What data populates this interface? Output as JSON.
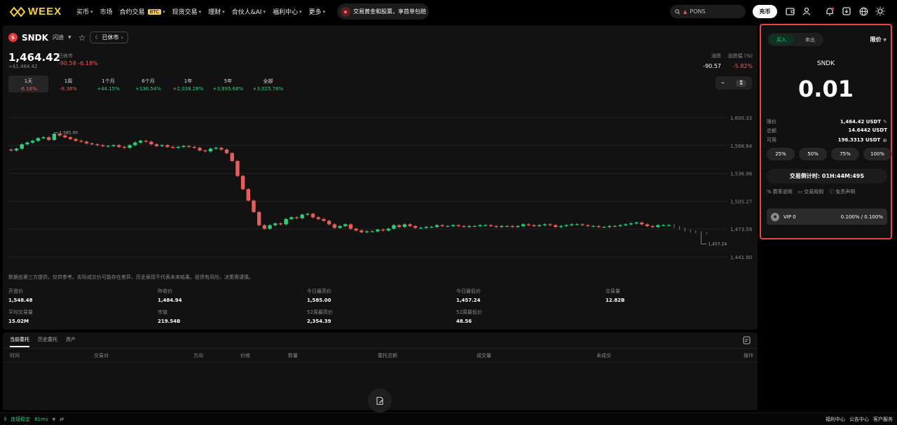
{
  "colors": {
    "accent": "#f4d03f",
    "up": "#2ecf7d",
    "down": "#e85d5d",
    "highlight_border": "#e84545"
  },
  "nav": {
    "logo": "WEEX",
    "items": [
      {
        "label": "买币",
        "chevron": true
      },
      {
        "label": "市场",
        "chevron": false
      },
      {
        "label": "合约交易",
        "badge": "BTC",
        "chevron": true
      },
      {
        "label": "现货交易",
        "chevron": true
      },
      {
        "label": "理财",
        "chevron": true
      },
      {
        "label": "合伙人&AI",
        "chevron": true
      },
      {
        "label": "福利中心",
        "chevron": true
      },
      {
        "label": "更多",
        "chevron": true
      }
    ],
    "promo": "交易黄金和股票，享首单包赔",
    "search_placeholder": "PONS",
    "deposit": "充币",
    "icons": [
      "wallet-icon",
      "user-icon",
      "bell-icon",
      "download-icon",
      "globe-icon",
      "sun-icon"
    ]
  },
  "symbol": {
    "name": "SNDK",
    "sub": "闪迪",
    "market_status": "已休市",
    "price": "1,464.42",
    "price_usd": "≈$1,464.42",
    "closed_label": "已休市",
    "closed_change": "-90.58 -6.18%",
    "change_label": "涨跌",
    "change_value": "-90.57",
    "pct_label": "涨跌幅 (%)",
    "pct_value": "-5.82%"
  },
  "periods": [
    {
      "name": "1天",
      "pct": "-6.18%",
      "dir": "down",
      "active": true
    },
    {
      "name": "1周",
      "pct": "-8.38%",
      "dir": "down",
      "active": false
    },
    {
      "name": "1个月",
      "pct": "+44.15%",
      "dir": "up",
      "active": false
    },
    {
      "name": "6个月",
      "pct": "+136.54%",
      "dir": "up",
      "active": false
    },
    {
      "name": "1年",
      "pct": "+2,038.28%",
      "dir": "up",
      "active": false
    },
    {
      "name": "5年",
      "pct": "+3,895.68%",
      "dir": "up",
      "active": false
    },
    {
      "name": "全部",
      "pct": "+3,025.76%",
      "dir": "up",
      "active": false
    }
  ],
  "chart_data": {
    "type": "candlestick",
    "y_ticks": [
      "1,600.33",
      "1,568.64",
      "1,536.96",
      "1,505.27",
      "1,473.59",
      "1,441.90"
    ],
    "ylim": [
      1441.9,
      1600.33
    ],
    "annotations": {
      "high": "1,585.00",
      "low": "1,457.24"
    },
    "closes": [
      1563,
      1565,
      1570,
      1572,
      1574,
      1577,
      1578,
      1575,
      1582,
      1580,
      1578,
      1576,
      1574,
      1573,
      1571,
      1570,
      1569,
      1568,
      1568,
      1569,
      1567,
      1566,
      1569,
      1572,
      1574,
      1573,
      1570,
      1568,
      1569,
      1567,
      1566,
      1567,
      1568,
      1567,
      1566,
      1563,
      1562,
      1565,
      1566,
      1564,
      1560,
      1551,
      1534,
      1519,
      1506,
      1493,
      1478,
      1474,
      1478,
      1480,
      1479,
      1485,
      1487,
      1486,
      1490,
      1491,
      1487,
      1485,
      1483,
      1479,
      1475,
      1477,
      1479,
      1474,
      1472,
      1470,
      1471,
      1471,
      1473,
      1472,
      1474,
      1478,
      1476,
      1479,
      1477,
      1475,
      1475,
      1476,
      1476,
      1478,
      1477,
      1477,
      1478,
      1477,
      1476,
      1477,
      1477,
      1478,
      1478,
      1477,
      1476,
      1477,
      1477,
      1476,
      1477,
      1479,
      1478,
      1477,
      1478,
      1479,
      1478,
      1476,
      1477,
      1478,
      1479,
      1479,
      1478,
      1477,
      1477,
      1476,
      1476,
      1477,
      1477,
      1478,
      1479,
      1480,
      1481,
      1479,
      1477,
      1476,
      1478,
      1478,
      1478,
      1476,
      1474,
      1472,
      1471,
      1470,
      1469,
      1469
    ],
    "closed_after_index": 122
  },
  "disclaimer": "数据由第三方提供，仅供参考。实际成交价可能存在差异，历史表现不代表未来结果。投资有风险，决策需谨慎。",
  "stats": [
    {
      "label": "开盘价",
      "value": "1,548.48"
    },
    {
      "label": "昨收价",
      "value": "1,484.94"
    },
    {
      "label": "今日最高价",
      "value": "1,585.00"
    },
    {
      "label": "今日最低价",
      "value": "1,457.24"
    },
    {
      "label": "交易量",
      "value": "12.82B"
    },
    {
      "label": "平均交易量",
      "value": "15.02M"
    },
    {
      "label": "市值",
      "value": "219.54B"
    },
    {
      "label": "52周最高价",
      "value": "2,354.39"
    },
    {
      "label": "52周最低价",
      "value": "48.56"
    }
  ],
  "orders": {
    "tabs": [
      "当前委托",
      "历史委托",
      "资产"
    ],
    "columns": [
      "时间",
      "交易对",
      "方向",
      "价格",
      "数量",
      "委托总额",
      "成交量",
      "未成交",
      "操作"
    ]
  },
  "trade": {
    "buy": "买入",
    "sell": "卖出",
    "order_type": "限价",
    "symbol": "SNDK",
    "qty": "0.01",
    "limit_label": "限价",
    "limit_value": "1,464.42 USDT",
    "total_label": "总额",
    "total_value": "14.6442 USDT",
    "avail_label": "可用",
    "avail_value": "196.3313 USDT",
    "pcts": [
      "25%",
      "50%",
      "75%",
      "100%"
    ],
    "countdown": "交易倒计时: 01H:44M:49S",
    "links": [
      "费率说明",
      "交易规则",
      "免责声明"
    ],
    "vip": "VIP 0",
    "fees": "0.100% / 0.100%"
  },
  "footer": {
    "status": "连接稳定",
    "latency": "81ms",
    "links": [
      "福利中心",
      "公告中心",
      "客户服务"
    ]
  }
}
